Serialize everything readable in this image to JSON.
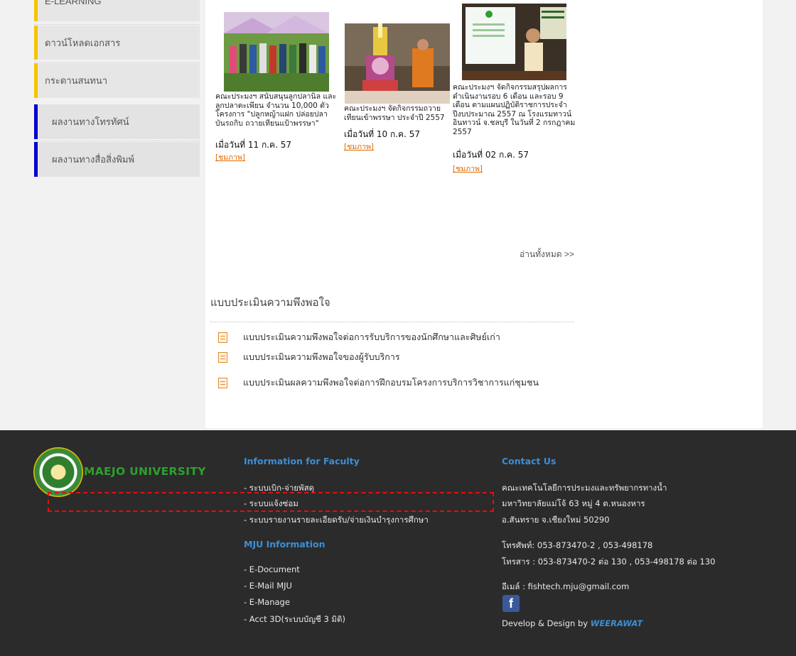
{
  "sidebar": {
    "items": [
      {
        "label": "E-LEARNING"
      },
      {
        "label": "ดาวน์โหลดเอกสาร"
      },
      {
        "label": "กระดานสนทนา"
      },
      {
        "label": "ผลงานทางโทรทัศน์"
      },
      {
        "label": "ผลงานทางสื่อสิ่งพิมพ์"
      }
    ]
  },
  "news": [
    {
      "text": "คณะประมงฯ สนับสนุนลูกปลานิล และลูกปลาตะเพียน จำนวน 10,000 ตัว โครงการ \"ปลูกหญ้าแฝก ปล่อยปลา บันรถกิบ ถวายเทียนแป้าพรรษา\"",
      "date": "เมื่อวันที่ 11 ก.ค. 57",
      "more": "[ชมภาพ]"
    },
    {
      "text": "คณะประมงฯ จัดกิจกรรมถวายเทียนเข้าพรรษา ประจำปี 2557",
      "date": "เมื่อวันที่ 10 ก.ค. 57",
      "more": "[ชมภาพ]"
    },
    {
      "text": "คณะประมงฯ จัดกิจกรรมสรุปผลการดำเนินงานรอบ 6 เดือน และรอบ 9 เดือน ตามแผนปฏิบัติราชการประจำปีงบประมาณ 2557 ณ โรงแรมทาวน์อินทาวน์ จ.ชลบุรี ในวันที่ 2 กรกฎาคม 2557",
      "date": "เมื่อวันที่ 02 ก.ค. 57",
      "more": "[ชมภาพ]"
    }
  ],
  "read_all": "อ่านทั้งหมด >>",
  "survey": {
    "title": "แบบประเมินความพึงพอใจ",
    "items": [
      {
        "label": "แบบประเมินความพึงพอใจต่อการรับบริการของนักศึกษาและศิษย์เก่า"
      },
      {
        "label": "แบบประเมินความพึงพอใจของผู้รับบริการ"
      },
      {
        "label": "แบบประเมินผลความพึงพอใจต่อการฝึกอบรมโครงการบริการวิชาการแก่ชุมชน"
      }
    ]
  },
  "footer": {
    "logo_text": "MAEJO UNIVERSITY",
    "faculty": {
      "heading": "Information for Faculty",
      "links": [
        "- ระบบเบิก-จ่ายพัสดุ",
        "- ระบบแจ้งซ่อม",
        "- ระบบรายงานรายละเอียดรับ/จ่ายเงินบำรุงการศึกษา"
      ]
    },
    "mju": {
      "heading": "MJU Information",
      "links": [
        "- E-Document",
        "- E-Mail MJU",
        "- E-Manage",
        "- Acct 3D(ระบบบัญชี 3 มิติ)"
      ]
    },
    "contact": {
      "heading": "Contact Us",
      "address_lines": [
        "คณะเทคโนโลยีการประมงและทรัพยากรทางน้ำ",
        "มหาวิทยาลัยแม่โจ้ 63 หมู่ 4 ต.หนองหาร",
        "อ.สันทราย จ.เชียงใหม่ 50290"
      ],
      "phone": "โทรศัพท์: 053-873470-2 , 053-498178",
      "fax": "โทรสาร : 053-873470-2 ต่อ 130 , 053-498178 ต่อ 130",
      "email": "อีเมล์ : fishtech.mju@gmail.com",
      "facebook_icon": "facebook-icon",
      "develop_prefix": "Develop & Design by ",
      "develop_name": "WEERAWAT"
    }
  },
  "colors": {
    "footer_bg": "#2b2b2b",
    "footer_heading": "#3c8fd6",
    "sidebar_gold": "#f5c400",
    "sidebar_blue": "#0000cc",
    "link_orange": "#e06b00",
    "highlight": "#e01010"
  }
}
